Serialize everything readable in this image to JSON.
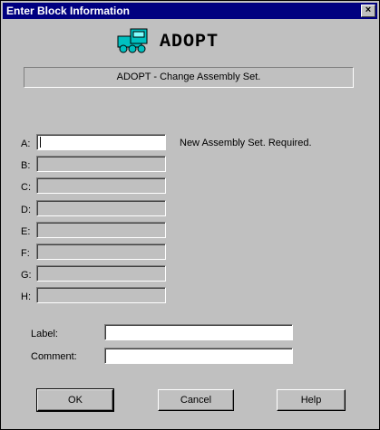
{
  "window": {
    "title": "Enter Block Information",
    "close_label": "×"
  },
  "header": {
    "block_name": "ADOPT",
    "description": "ADOPT - Change Assembly Set."
  },
  "fields": [
    {
      "label": "A:",
      "value": ""
    },
    {
      "label": "B:",
      "value": ""
    },
    {
      "label": "C:",
      "value": ""
    },
    {
      "label": "D:",
      "value": ""
    },
    {
      "label": "E:",
      "value": ""
    },
    {
      "label": "F:",
      "value": ""
    },
    {
      "label": "G:",
      "value": ""
    },
    {
      "label": "H:",
      "value": ""
    }
  ],
  "hint": "New Assembly Set. Required.",
  "label_field": {
    "label": "Label:",
    "value": ""
  },
  "comment_field": {
    "label": "Comment:",
    "value": ""
  },
  "buttons": {
    "ok": "OK",
    "cancel": "Cancel",
    "help": "Help"
  },
  "colors": {
    "titlebar": "#000080",
    "face": "#c0c0c0",
    "icon": "#00c0c0"
  }
}
